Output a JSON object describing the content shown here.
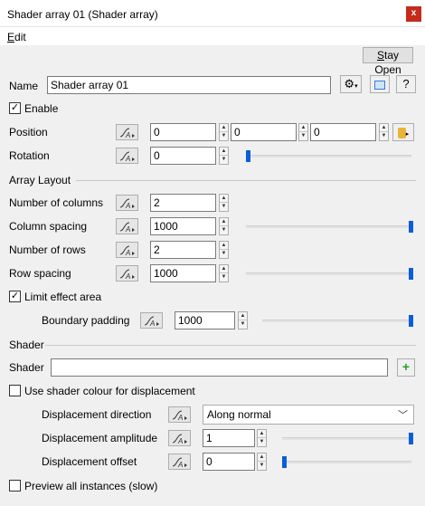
{
  "window": {
    "title": "Shader array 01     (Shader array)",
    "close": "x"
  },
  "menu": {
    "edit_mnemonic": "E",
    "edit_rest": "dit"
  },
  "toolbar": {
    "stay_open_mnemonic": "S",
    "stay_open_rest": "tay Open"
  },
  "name": {
    "label": "Name",
    "value": "Shader array 01",
    "help": "?"
  },
  "enable": {
    "label": "Enable",
    "checked": true
  },
  "position": {
    "label": "Position",
    "x": "0",
    "y": "0",
    "z": "0"
  },
  "rotation": {
    "label": "Rotation",
    "value": "0",
    "slider_fraction": 0.0
  },
  "array_layout": {
    "heading": "Array Layout",
    "columns": {
      "label": "Number of columns",
      "value": "2"
    },
    "column_spacing": {
      "label": "Column spacing",
      "value": "1000",
      "slider_fraction": 1.0
    },
    "rows": {
      "label": "Number of rows",
      "value": "2"
    },
    "row_spacing": {
      "label": "Row spacing",
      "value": "1000",
      "slider_fraction": 1.0
    },
    "limit_effect": {
      "label": "Limit effect area",
      "checked": true
    },
    "boundary_padding": {
      "label": "Boundary padding",
      "value": "1000",
      "slider_fraction": 1.0
    }
  },
  "shader": {
    "heading": "Shader",
    "field_label": "Shader",
    "field_value": "",
    "use_colour": {
      "label": "Use shader colour for displacement",
      "checked": false
    },
    "displacement_direction": {
      "label": "Displacement direction",
      "value": "Along normal"
    },
    "displacement_amplitude": {
      "label": "Displacement amplitude",
      "value": "1",
      "slider_fraction": 1.0
    },
    "displacement_offset": {
      "label": "Displacement offset",
      "value": "0",
      "slider_fraction": 0.0
    }
  },
  "preview": {
    "label": "Preview all instances (slow)",
    "checked": false
  },
  "colors": {
    "accent": "#0a5fd6",
    "close": "#c42b1c",
    "add": "#2a9d2a"
  }
}
